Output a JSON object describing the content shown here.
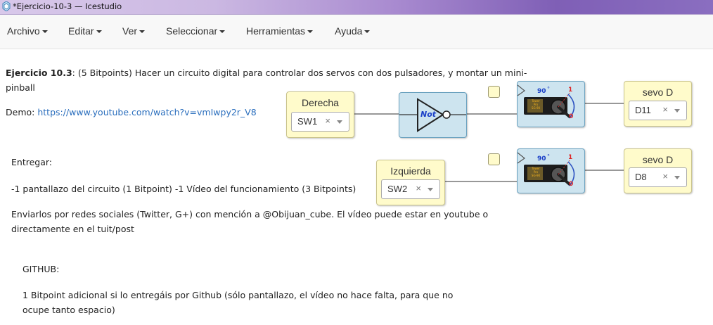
{
  "window": {
    "title": "*Ejercicio-10-3 — Icestudio"
  },
  "menu": [
    {
      "label": "Archivo"
    },
    {
      "label": "Editar"
    },
    {
      "label": "Ver"
    },
    {
      "label": "Seleccionar"
    },
    {
      "label": "Herramientas"
    },
    {
      "label": "Ayuda"
    }
  ],
  "info": {
    "heading": "Ejercicio 10.3",
    "line1_rest": ": (5 Bitpoints) Hacer un circuito digital para controlar dos servos con dos pulsadores, y montar un mini-",
    "line2": "pinball",
    "demo_label": "Demo:",
    "demo_link": "https://www.youtube.com/watch?v=vmIwpy2r_V8",
    "entregar": "Entregar:",
    "entregar_items": "-1 pantallazo del circuito (1 Bitpoint) -1 Vídeo del funcionamiento (3 Bitpoints)",
    "enviar_line1": "Enviarlos por redes sociales (Twitter, G+) con mención a @Obijuan_cube. El vídeo puede estar en youtube o",
    "enviar_line2": "directamente en el tuit/post",
    "github": "GITHUB:",
    "github_line1": "1 Bitpoint adicional si lo entregáis por Github (sólo pantallazo, el vídeo no hace falta, para que no",
    "github_line2": "ocupe tanto espacio)"
  },
  "blocks": {
    "derecha": {
      "label": "Derecha",
      "value": "SW1",
      "clear": "×"
    },
    "izquierda": {
      "label": "Izquierda",
      "value": "SW2",
      "clear": "×"
    },
    "not_gate": {
      "label": "Not"
    },
    "servo": {
      "angle": "90",
      "degree": "°",
      "one": "1",
      "zero": "0",
      "brand_lines": [
        "Tower",
        "Pro",
        "SG-90"
      ]
    },
    "sevo_top": {
      "label": "sevo D",
      "value": "D11",
      "clear": "×"
    },
    "sevo_bottom": {
      "label": "sevo D",
      "value": "D8",
      "clear": "×"
    }
  },
  "colors": {
    "io_block": "#fffbcb",
    "logic_block": "#cde4ef",
    "link": "#2a6ebd",
    "wire": "#777777"
  }
}
